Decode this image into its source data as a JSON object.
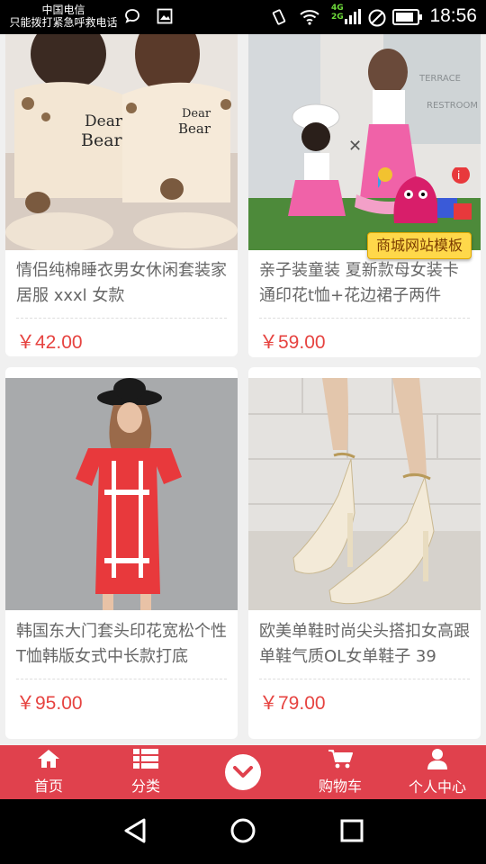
{
  "status_bar": {
    "carrier_name": "中国电信",
    "carrier_note": "只能拨打紧急呼救电话",
    "network_label_top": "4G",
    "network_label_bottom": "2G",
    "time": "18:56"
  },
  "products": [
    {
      "title": "情侣纯棉睡衣男女休闲套装家居服 xxxl 女款",
      "price": "￥42.00",
      "image_icon": "couple-pajamas-photo"
    },
    {
      "title": "亲子装童装 夏新款母女装卡通印花t恤+花边裙子两件",
      "price": "￥59.00",
      "image_icon": "mother-daughter-outfit-photo"
    },
    {
      "title": "韩国东大门套头印花宽松个性T恤韩版女式中长款打底",
      "price": "￥95.00",
      "image_icon": "red-tshirt-dress-photo"
    },
    {
      "title": "欧美单鞋时尚尖头搭扣女高跟单鞋气质OL女单鞋子 39",
      "price": "￥79.00",
      "image_icon": "beige-high-heels-photo"
    }
  ],
  "promo": {
    "label": "商城网站模板"
  },
  "bottom_nav": {
    "items": [
      {
        "label": "首页",
        "icon": "home-icon"
      },
      {
        "label": "分类",
        "icon": "list-icon"
      },
      {
        "label": "",
        "icon": "chevron-down-icon"
      },
      {
        "label": "购物车",
        "icon": "cart-icon"
      },
      {
        "label": "个人中心",
        "icon": "user-icon"
      }
    ]
  },
  "colors": {
    "accent": "#e0414d",
    "price": "#e64340"
  }
}
